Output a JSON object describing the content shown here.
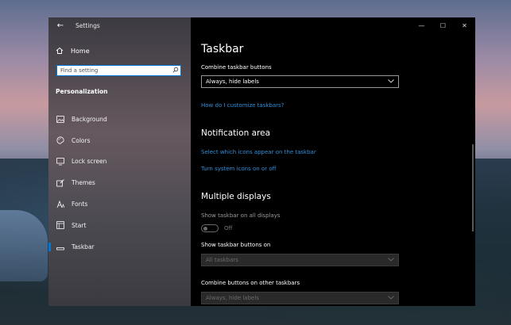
{
  "window": {
    "title": "Settings",
    "controls": {
      "minimize": "—",
      "maximize": "☐",
      "close": "✕"
    }
  },
  "sidebar": {
    "back_icon": "←",
    "home": {
      "icon": "home-icon",
      "label": "Home"
    },
    "search": {
      "placeholder": "Find a setting",
      "value": ""
    },
    "section": "Personalization",
    "items": [
      {
        "icon": "image-icon",
        "label": "Background",
        "active": false
      },
      {
        "icon": "palette-icon",
        "label": "Colors",
        "active": false
      },
      {
        "icon": "monitor-icon",
        "label": "Lock screen",
        "active": false
      },
      {
        "icon": "brush-icon",
        "label": "Themes",
        "active": false
      },
      {
        "icon": "font-icon",
        "label": "Fonts",
        "active": false
      },
      {
        "icon": "start-icon",
        "label": "Start",
        "active": false
      },
      {
        "icon": "taskbar-icon",
        "label": "Taskbar",
        "active": true
      }
    ]
  },
  "main": {
    "title": "Taskbar",
    "combine": {
      "label": "Combine taskbar buttons",
      "value": "Always, hide labels"
    },
    "customize_link": "How do I customize taskbars?",
    "notification": {
      "heading": "Notification area",
      "link1": "Select which icons appear on the taskbar",
      "link2": "Turn system icons on or off"
    },
    "multiple": {
      "heading": "Multiple displays",
      "show_all_label": "Show taskbar on all displays",
      "show_all_state": "Off",
      "buttons_on_label": "Show taskbar buttons on",
      "buttons_on_value": "All taskbars",
      "combine_other_label": "Combine buttons on other taskbars",
      "combine_other_value": "Always, hide labels"
    }
  },
  "colors": {
    "accent": "#0078d7",
    "link": "#2f8fd8",
    "background": "#000000"
  }
}
